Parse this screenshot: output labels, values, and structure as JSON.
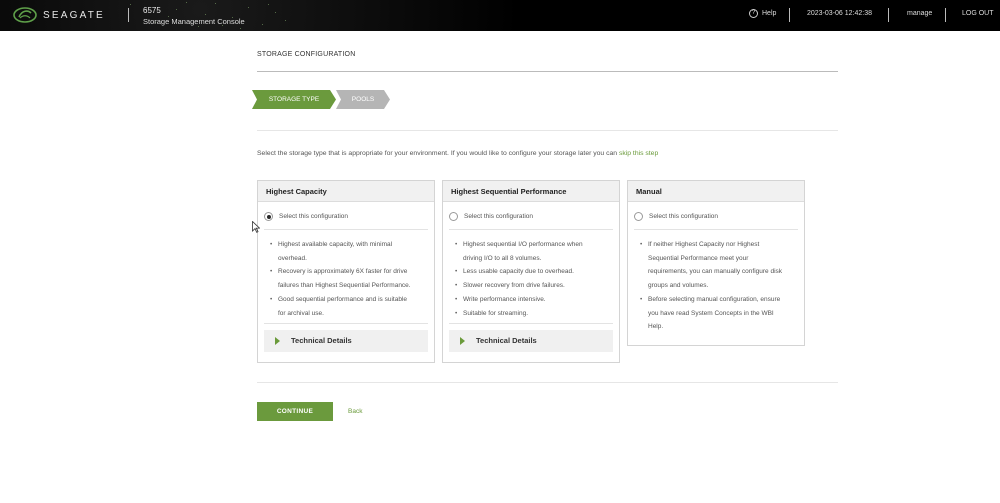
{
  "header": {
    "brand": "SEAGATE",
    "system_model": "6575",
    "console_title": "Storage Management Console",
    "help_label": "Help",
    "help_icon": "question-circle-icon",
    "datetime": "2023-03-06 12:42:38",
    "user": "manage",
    "logout_label": "LOG OUT"
  },
  "page": {
    "title": "STORAGE CONFIGURATION",
    "steps": [
      {
        "label": "STORAGE TYPE",
        "active": true
      },
      {
        "label": "POOLS",
        "active": false
      }
    ],
    "intro_text": "Select the storage type that is appropriate for your environment. If you would like to configure your storage later you can ",
    "intro_link": "skip this step",
    "radio_label": "Select this configuration",
    "tech_details_label": "Technical Details",
    "continue_label": "CONTINUE",
    "back_label": "Back"
  },
  "options": [
    {
      "title": "Highest Capacity",
      "selected": true,
      "bullets": [
        "Highest available capacity, with minimal",
        "overhead.",
        "Recovery is approximately 6X faster for drive",
        "failures than Highest Sequential Performance.",
        "Good sequential performance and is suitable",
        "for archival use."
      ]
    },
    {
      "title": "Highest Sequential Performance",
      "selected": false,
      "bullets": [
        "Highest sequential I/O performance when",
        "driving I/O to all 8 volumes.",
        "Less usable capacity due to overhead.",
        "Slower recovery from drive failures.",
        "Write performance intensive.",
        "Suitable for streaming."
      ]
    },
    {
      "title": "Manual",
      "selected": false,
      "bullets": [
        "If neither Highest Capacity nor Highest",
        "Sequential Performance meet your",
        "requirements, you can manually configure disk",
        "groups and volumes.",
        "Before selecting manual configuration, ensure",
        "you have read System Concepts in the WBI",
        "Help."
      ]
    }
  ],
  "colors": {
    "accent_green": "#6b9a3d",
    "step_inactive": "#b5b5b5",
    "topbar": "#000000"
  }
}
